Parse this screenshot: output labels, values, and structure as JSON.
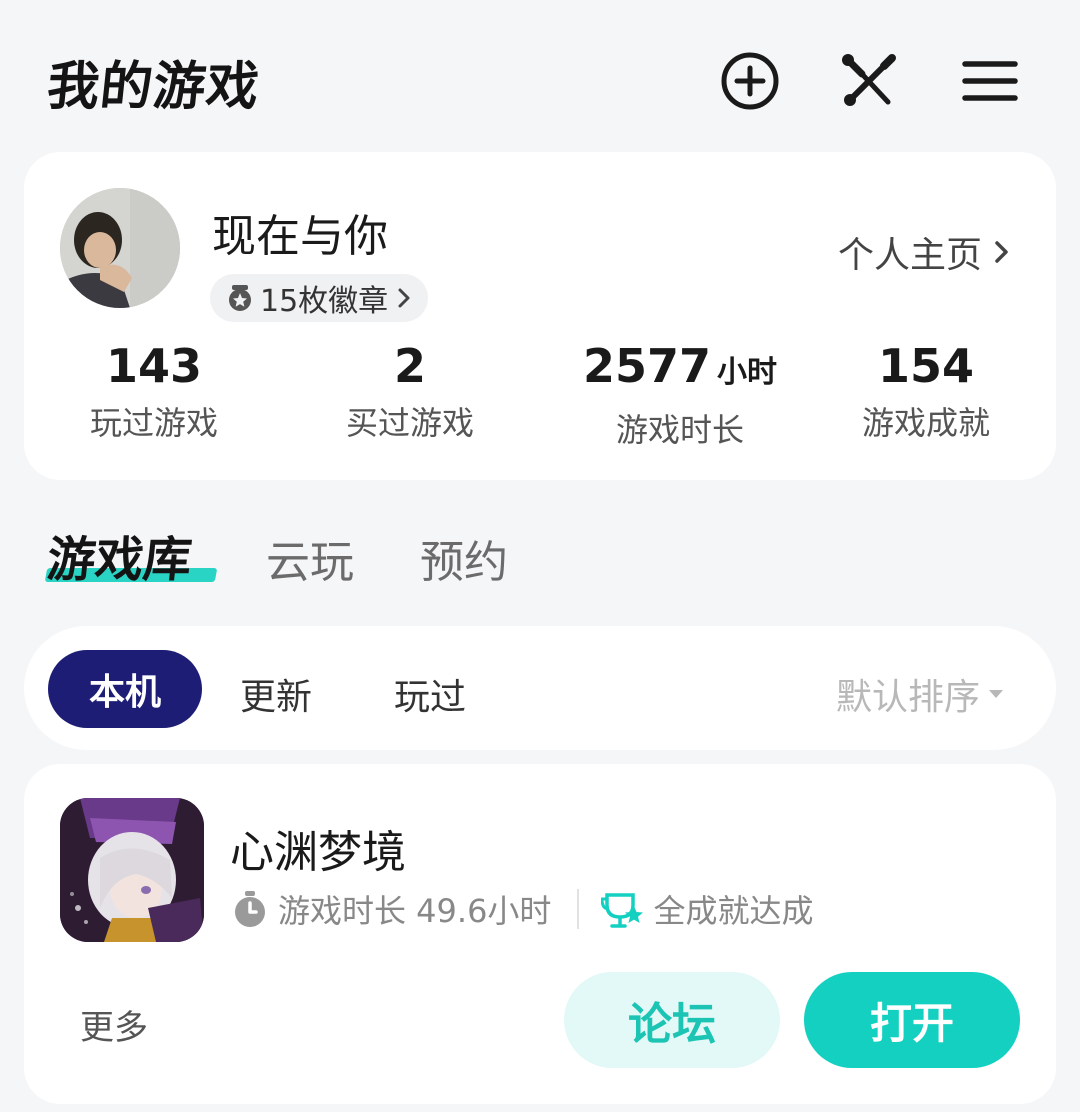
{
  "header": {
    "title": "我的游戏",
    "icons": [
      "plus-circle-icon",
      "tools-icon",
      "menu-icon"
    ]
  },
  "profile": {
    "username": "现在与你",
    "badges_label": "15枚徽章",
    "profile_link": "个人主页",
    "stats": [
      {
        "value": "143",
        "unit": "",
        "label": "玩过游戏"
      },
      {
        "value": "2",
        "unit": "",
        "label": "买过游戏"
      },
      {
        "value": "2577",
        "unit": "小时",
        "label": "游戏时长"
      },
      {
        "value": "154",
        "unit": "",
        "label": "游戏成就"
      }
    ]
  },
  "tabs": [
    {
      "label": "游戏库",
      "active": true
    },
    {
      "label": "云玩",
      "active": false
    },
    {
      "label": "预约",
      "active": false
    }
  ],
  "filters": {
    "chips": [
      "本机",
      "更新",
      "玩过"
    ],
    "active": "本机",
    "sort_label": "默认排序"
  },
  "game": {
    "title": "心渊梦境",
    "playtime": "游戏时长 49.6小时",
    "achievement": "全成就达成",
    "more_label": "更多",
    "forum_label": "论坛",
    "open_label": "打开"
  },
  "colors": {
    "accent": "#14d0c0",
    "chip_active": "#1d1d76",
    "forum_bg": "#e3f9f7"
  }
}
